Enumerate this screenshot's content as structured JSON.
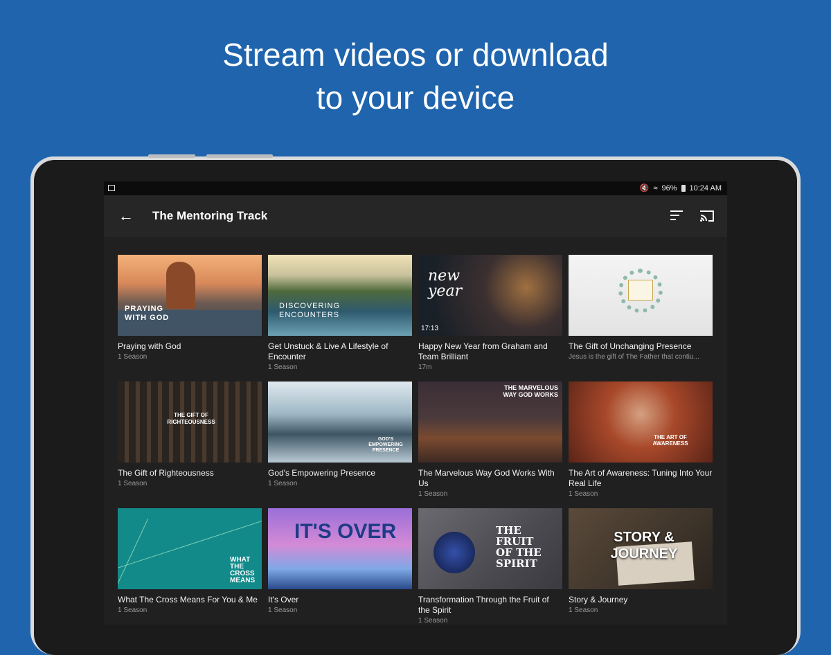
{
  "headline": {
    "line1": "Stream videos or download",
    "line2": "to your device"
  },
  "status_bar": {
    "battery": "96%",
    "time": "10:24 AM"
  },
  "app_bar": {
    "title": "The Mentoring Track"
  },
  "cards": [
    {
      "title": "Praying with God",
      "subtitle": "1 Season",
      "thumb_text": "PRAYING WITH GOD"
    },
    {
      "title": "Get Unstuck & Live A Lifestyle of Encounter",
      "subtitle": "1 Season",
      "thumb_text": "DISCOVERING ENCOUNTERS"
    },
    {
      "title": "Happy New Year from Graham and Team Brilliant",
      "subtitle": "17m",
      "thumb_text": "new year",
      "duration": "17:13"
    },
    {
      "title": "The Gift of Unchanging Presence",
      "subtitle": "Jesus is the gift of The Father that contiu..."
    },
    {
      "title": "The Gift of Righteousness",
      "subtitle": "1 Season",
      "thumb_text": "THE GIFT OF RIGHTEOUSNESS"
    },
    {
      "title": "God's Empowering Presence",
      "subtitle": "1 Season",
      "thumb_text": "GOD'S EMPOWERING PRESENCE"
    },
    {
      "title": "The Marvelous Way God Works With Us",
      "subtitle": "1 Season",
      "thumb_text": "THE MARVELOUS WAY GOD WORKS"
    },
    {
      "title": "The Art of Awareness: Tuning Into Your Real Life",
      "subtitle": "1 Season",
      "thumb_text": "THE ART OF AWARENESS"
    },
    {
      "title": "What The Cross Means For You & Me",
      "subtitle": "1 Season",
      "thumb_text": "WHAT THE CROSS MEANS"
    },
    {
      "title": "It's Over",
      "subtitle": "1 Season",
      "thumb_text": "IT'S OVER"
    },
    {
      "title": "Transformation Through the Fruit of the Spirit",
      "subtitle": "1 Season",
      "thumb_text": "THE FRUIT OF THE SPIRIT"
    },
    {
      "title": "Story & Journey",
      "subtitle": "1 Season",
      "thumb_text": "STORY & JOURNEY"
    }
  ]
}
